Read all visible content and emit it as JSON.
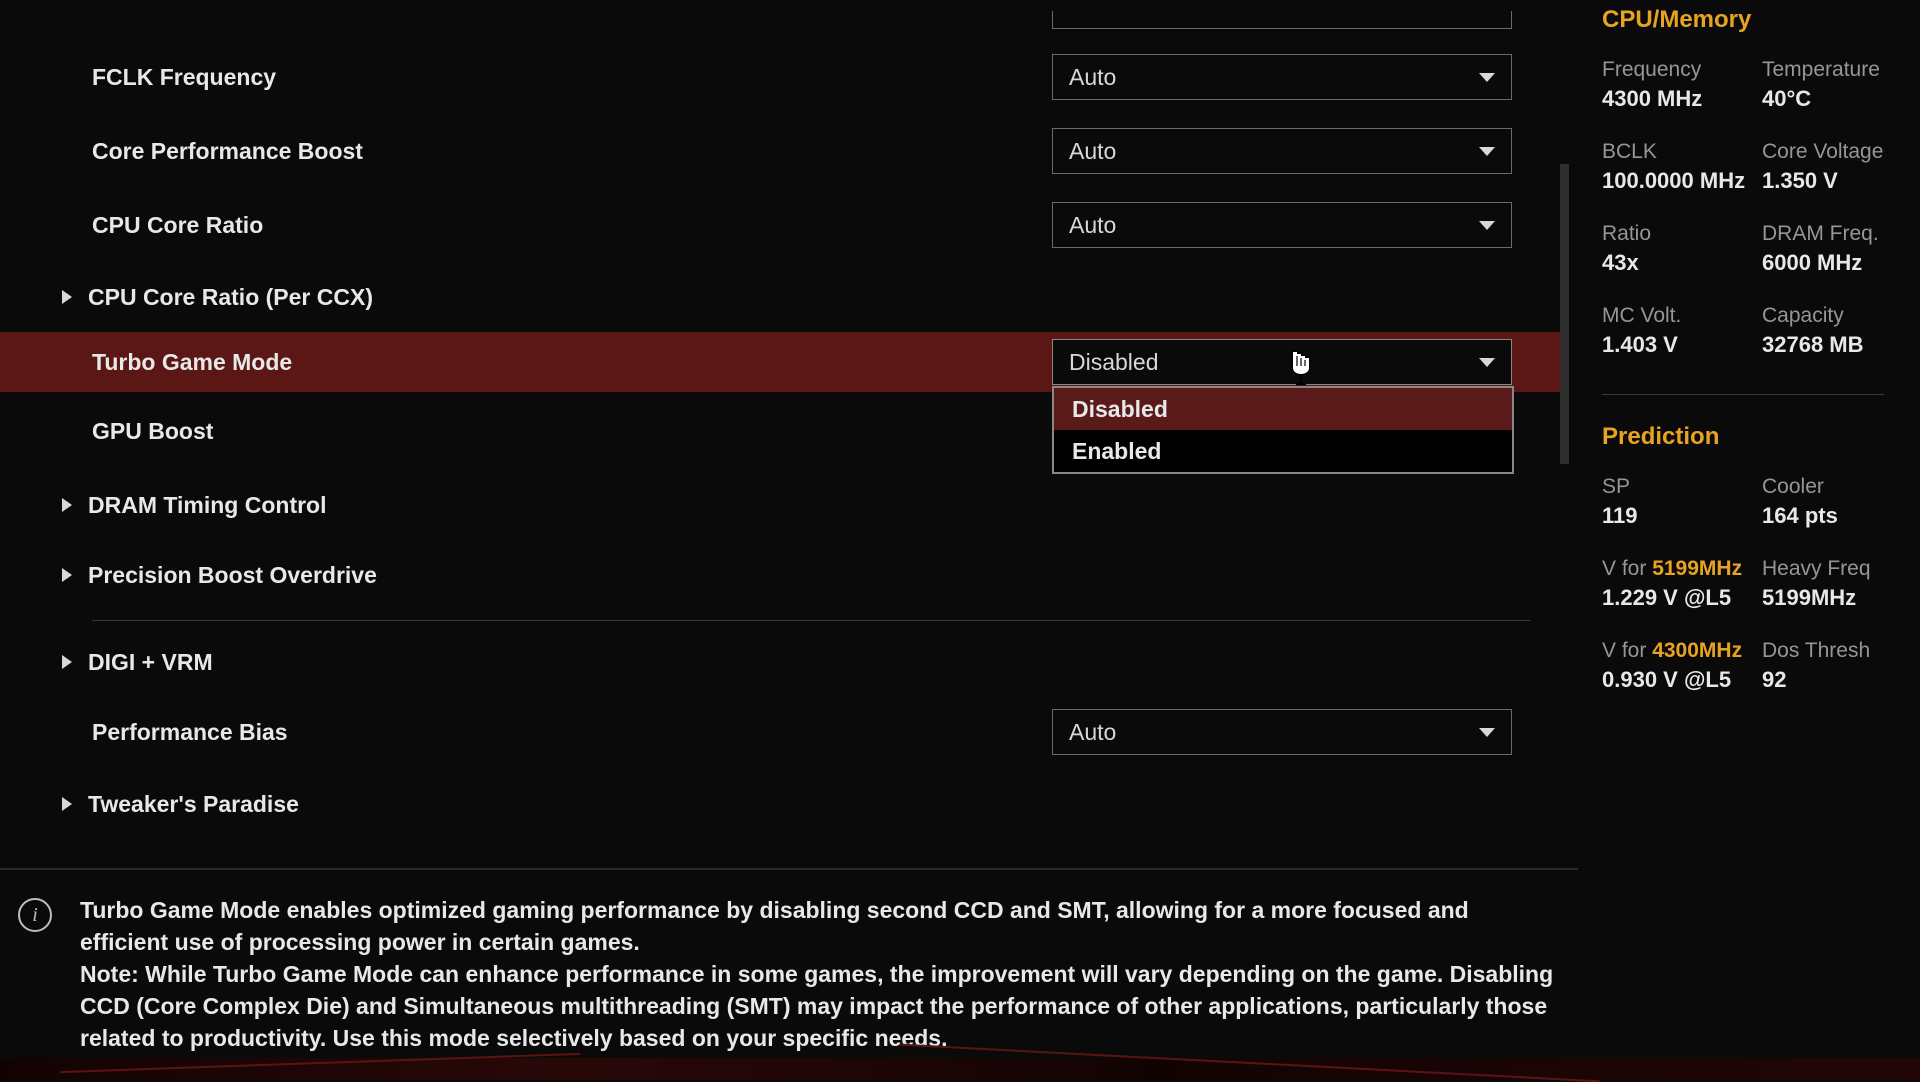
{
  "settings": {
    "fclk_label": "FCLK Frequency",
    "fclk_value": "Auto",
    "cpb_label": "Core Performance Boost",
    "cpb_value": "Auto",
    "cpu_ratio_label": "CPU Core Ratio",
    "cpu_ratio_value": "Auto",
    "ccx_label": "CPU Core Ratio (Per CCX)",
    "turbo_label": "Turbo Game Mode",
    "turbo_value": "Disabled",
    "turbo_options": {
      "disabled": "Disabled",
      "enabled": "Enabled"
    },
    "gpu_boost_label": "GPU Boost",
    "dram_label": "DRAM Timing Control",
    "pbo_label": "Precision Boost Overdrive",
    "digi_label": "DIGI + VRM",
    "perf_bias_label": "Performance Bias",
    "perf_bias_value": "Auto",
    "tweaker_label": "Tweaker's Paradise"
  },
  "sidebar": {
    "cpu_memory_header": "CPU/Memory",
    "frequency_label": "Frequency",
    "frequency_value": "4300 MHz",
    "temperature_label": "Temperature",
    "temperature_value": "40°C",
    "bclk_label": "BCLK",
    "bclk_value": "100.0000 MHz",
    "core_voltage_label": "Core Voltage",
    "core_voltage_value": "1.350 V",
    "ratio_label": "Ratio",
    "ratio_value": "43x",
    "dram_freq_label": "DRAM Freq.",
    "dram_freq_value": "6000 MHz",
    "mc_volt_label": "MC Volt.",
    "mc_volt_value": "1.403 V",
    "capacity_label": "Capacity",
    "capacity_value": "32768 MB",
    "prediction_header": "Prediction",
    "sp_label": "SP",
    "sp_value": "119",
    "cooler_label": "Cooler",
    "cooler_value": "164 pts",
    "vfor1_pre": "V for ",
    "vfor1_hl": "5199MHz",
    "vfor1_b": "Heavy Freq",
    "vfor1_val": "1.229 V @L5",
    "vfor1_val_b": "5199MHz",
    "vfor2_pre": "V for ",
    "vfor2_hl": "4300MHz",
    "vfor2_b": "Dos Thresh",
    "vfor2_val": "0.930 V @L5",
    "vfor2_val_b": "92"
  },
  "info": {
    "text": "Turbo Game Mode enables optimized gaming performance by disabling second CCD and SMT, allowing for a more focused and efficient use of processing power in certain games.\nNote: While Turbo Game Mode can enhance performance in some games, the improvement will vary depending on the game. Disabling CCD (Core Complex Die) and Simultaneous multithreading (SMT) may impact the performance of other applications, particularly those related to productivity. Use this mode selectively based on your specific needs."
  }
}
